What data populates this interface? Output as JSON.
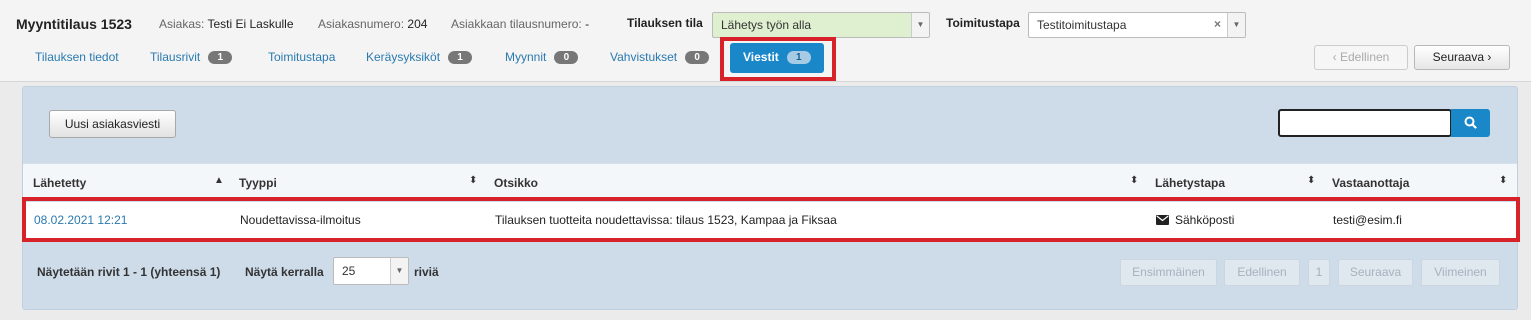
{
  "header": {
    "title": "Myyntitilaus 1523",
    "customer_label": "Asiakas:",
    "customer_value": "Testi Ei Laskulle",
    "customer_number_label": "Asiakasnumero:",
    "customer_number_value": "204",
    "customer_order_label": "Asiakkaan tilausnumero:",
    "customer_order_value": "-",
    "order_state_label": "Tilauksen tila",
    "order_state_value": "Lähetys työn alla",
    "delivery_label": "Toimitustapa",
    "delivery_value": "Testitoimitustapa",
    "clear_symbol": "×",
    "arrow_symbol": "▼"
  },
  "tabs": [
    {
      "label": "Tilauksen tiedot",
      "badge": null
    },
    {
      "label": "Tilausrivit",
      "badge": "1"
    },
    {
      "label": "Toimitustapa",
      "badge": null
    },
    {
      "label": "Keräysyksiköt",
      "badge": "1"
    },
    {
      "label": "Myynnit",
      "badge": "0"
    },
    {
      "label": "Vahvistukset",
      "badge": "0"
    },
    {
      "label": "Viestit",
      "badge": "1",
      "active": true
    }
  ],
  "nav": {
    "prev_label": "‹  Edellinen",
    "next_label": "Seuraava  ›"
  },
  "messages": {
    "new_button_label": "Uusi asiakasviesti",
    "search_value": "",
    "columns": [
      "Lähetetty",
      "Tyyppi",
      "Otsikko",
      "Lähetystapa",
      "Vastaanottaja"
    ],
    "sort_asc_symbol": "▲",
    "sort_both_symbol": "⬍",
    "rows": [
      {
        "sent": "08.02.2021 12:21",
        "type": "Noudettavissa-ilmoitus",
        "subject": "Tilauksen tuotteita noudettavissa: tilaus 1523, Kampaa ja Fiksaa",
        "method": "Sähköposti",
        "method_icon": "envelope-icon",
        "recipient": "testi@esim.fi"
      }
    ],
    "footer": {
      "showing": "Näytetään rivit 1 - 1 (yhteensä 1)",
      "per_page_label": "Näytä kerralla",
      "per_page_value": "25",
      "rows_label": "riviä"
    },
    "pagination": {
      "first": "Ensimmäinen",
      "prev": "Edellinen",
      "page": "1",
      "next": "Seuraava",
      "last": "Viimeinen"
    }
  },
  "colors": {
    "accent": "#1a87c9",
    "highlight": "#d8222a",
    "state_bg": "#dff0d0",
    "link": "#2a7ab0"
  }
}
